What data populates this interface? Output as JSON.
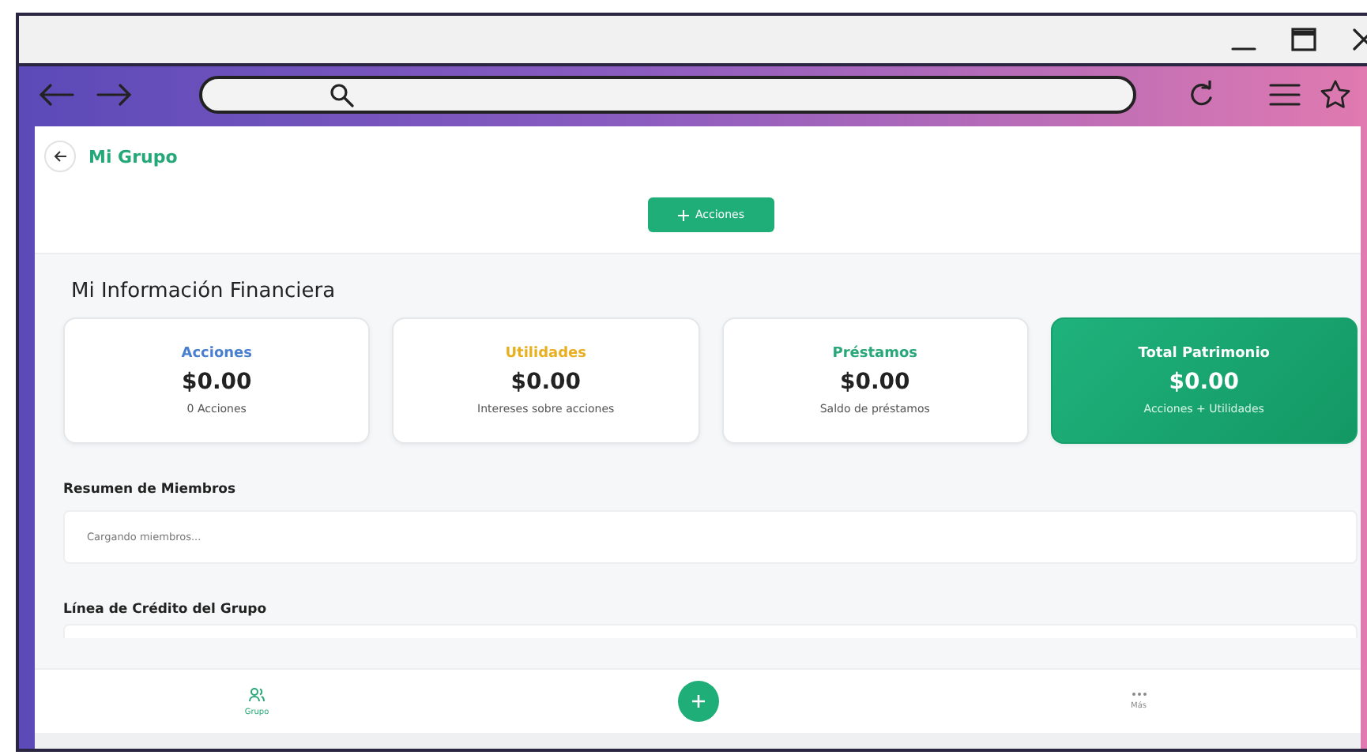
{
  "header": {
    "title": "Mi Grupo",
    "action_button": "Acciones"
  },
  "section_title": "Mi Información Financiera",
  "cards": [
    {
      "kind": "plain",
      "title": "Acciones",
      "color": "#4a7fd0",
      "value": "$0.00",
      "caption": "0 Acciones"
    },
    {
      "kind": "plain",
      "title": "Utilidades",
      "color": "#e8b020",
      "value": "$0.00",
      "caption": "Intereses sobre acciones"
    },
    {
      "kind": "plain",
      "title": "Préstamos",
      "color": "#27a77a",
      "value": "$0.00",
      "caption": "Saldo de préstamos"
    },
    {
      "kind": "highlight",
      "title": "Total Patrimonio",
      "color": "#ffffff",
      "value": "$0.00",
      "caption": "Acciones + Utilidades"
    }
  ],
  "members": {
    "title": "Resumen de Miembros",
    "status": "Cargando miembros..."
  },
  "credit": {
    "title": "Línea de Crédito del Grupo"
  },
  "bottom_nav": [
    {
      "kind": "group",
      "label": "Grupo",
      "selected": true
    },
    {
      "kind": "fab",
      "selected": false
    },
    {
      "kind": "more",
      "label": "Más",
      "selected": false
    }
  ]
}
